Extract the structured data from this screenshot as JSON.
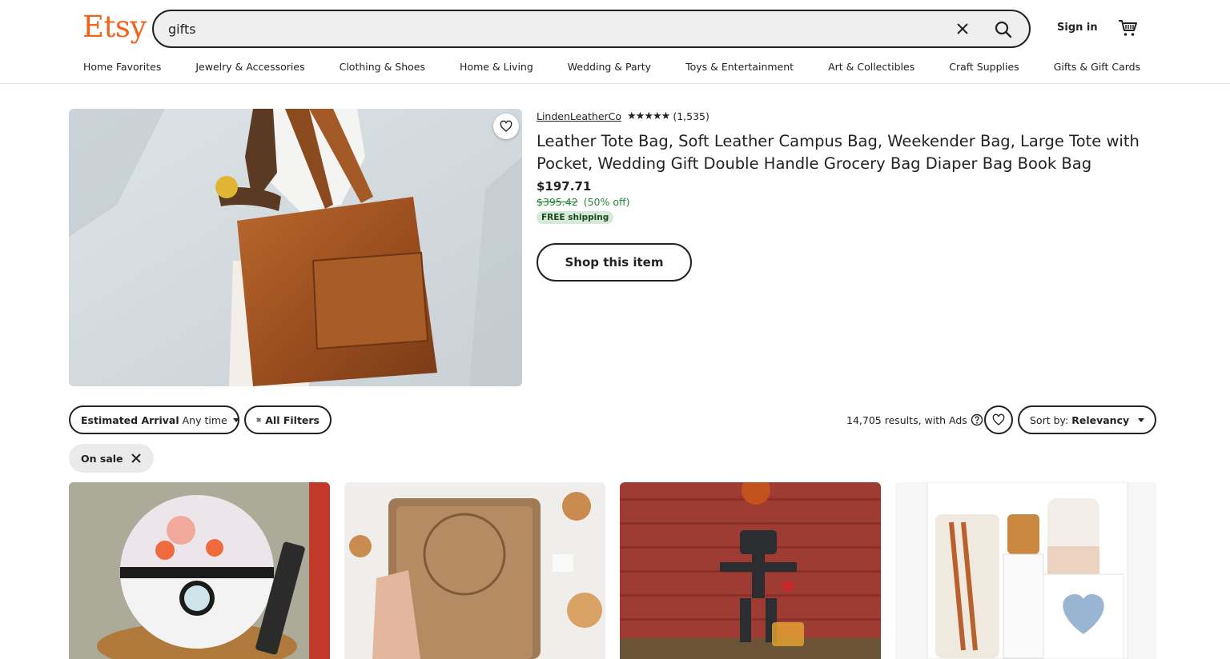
{
  "header": {
    "logo": "Etsy",
    "search_value": "gifts",
    "sign_in": "Sign in",
    "categories": [
      "Home Favorites",
      "Jewelry & Accessories",
      "Clothing & Shoes",
      "Home & Living",
      "Wedding & Party",
      "Toys & Entertainment",
      "Art & Collectibles",
      "Craft Supplies",
      "Gifts & Gift Cards"
    ]
  },
  "featured": {
    "shop_name": "LindenLeatherCo",
    "stars": "★★★★★",
    "rating": 5,
    "review_count": "(1,535)",
    "title": "Leather Tote Bag, Soft Leather Campus Bag, Weekender Bag, Large Tote with Pocket, Wedding Gift Double Handle Grocery Bag Diaper Bag Book Bag",
    "price": "$197.71",
    "original_price": "$395.42",
    "discount": "(50% off)",
    "shipping_badge": "FREE shipping",
    "cta": "Shop this item"
  },
  "filters": {
    "arrival_label": "Estimated Arrival",
    "arrival_value": "Any time",
    "all_filters": "All Filters",
    "results": "14,705 results, with Ads",
    "sort_label": "Sort by:",
    "sort_value": "Relevancy",
    "active_chip": "On sale"
  },
  "colors": {
    "brand": "#f1641e",
    "sale_green": "#258635",
    "ship_badge_bg": "#d4e9d7"
  }
}
